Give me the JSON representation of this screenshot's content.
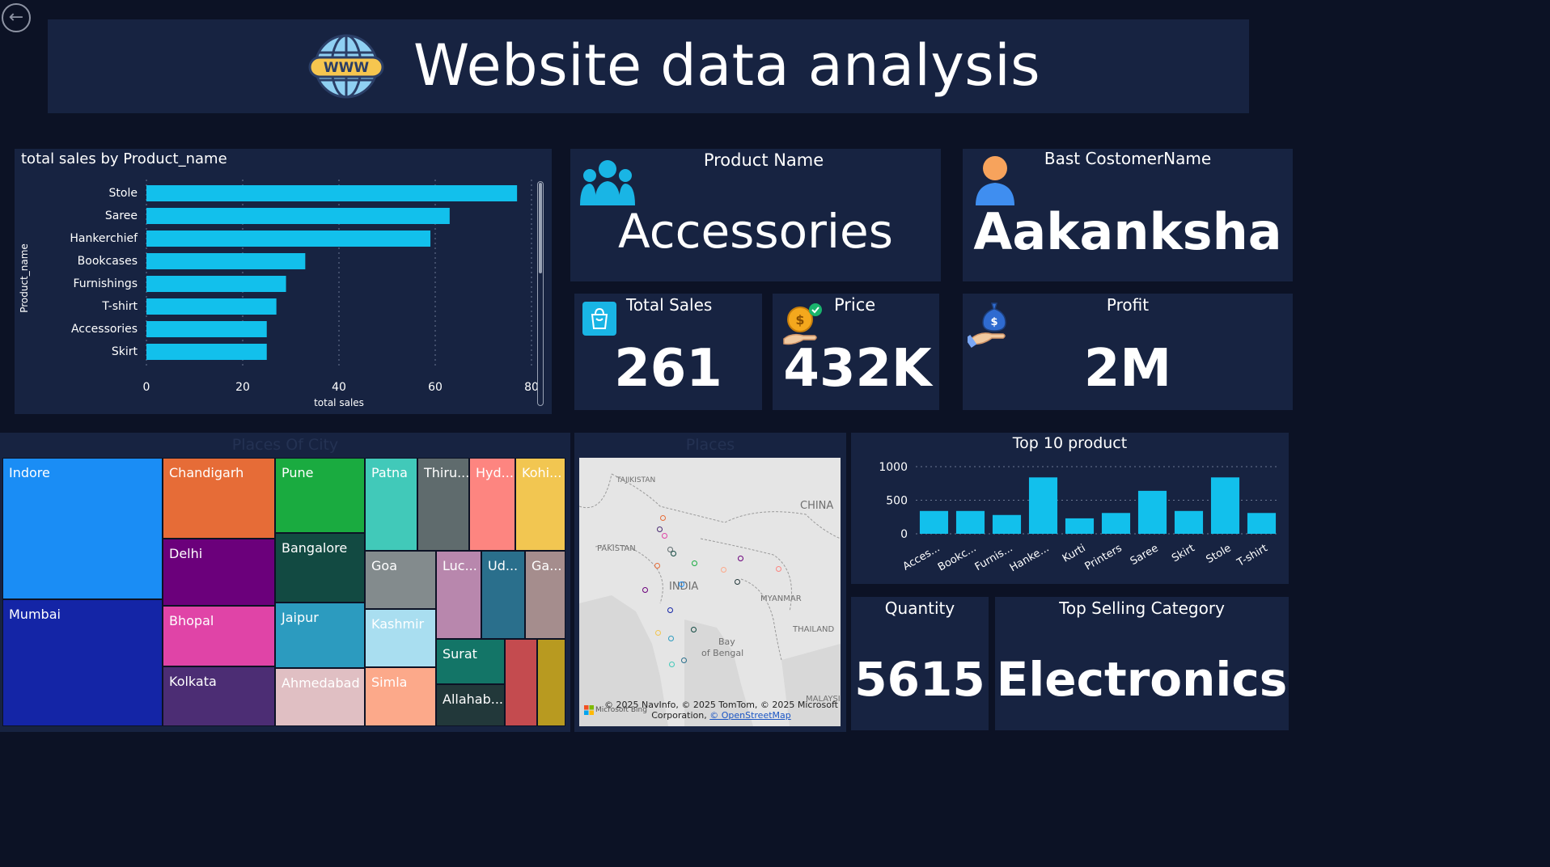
{
  "header": {
    "title": "Website data analysis",
    "icon": "www-globe-icon",
    "icon_text": "WWW"
  },
  "nav": {
    "back_icon": "back-arrow-icon"
  },
  "bar_chart": {
    "title": "total sales by Product_name",
    "chart_data": {
      "type": "bar",
      "orientation": "horizontal",
      "title": "total sales by Product_name",
      "xlabel": "total sales",
      "ylabel": "Product_name",
      "categories": [
        "Stole",
        "Saree",
        "Hankerchief",
        "Bookcases",
        "Furnishings",
        "T-shirt",
        "Accessories",
        "Skirt"
      ],
      "values": [
        77,
        63,
        59,
        33,
        29,
        27,
        25,
        25
      ],
      "xlim": [
        0,
        80
      ],
      "xticks": [
        0,
        20,
        40,
        60,
        80
      ],
      "grid": true,
      "color": "#12c0ec"
    }
  },
  "cards": {
    "product_name": {
      "label": "Product Name",
      "value": "Accessories",
      "icon": "people-group-icon"
    },
    "best_customer": {
      "label": "Bast CostomerName",
      "value": "Aakanksha",
      "icon": "user-avatar-icon"
    },
    "total_sales": {
      "label": "Total Sales",
      "value": "261",
      "icon": "shopping-bag-icon"
    },
    "price": {
      "label": "Price",
      "value": "432K",
      "icon": "coin-hand-icon"
    },
    "profit": {
      "label": "Profit",
      "value": "2M",
      "icon": "money-bag-hand-icon"
    },
    "quantity": {
      "label": "Quantity",
      "value": "5615"
    },
    "top_category": {
      "label": "Top Selling Category",
      "value": "Electronics"
    }
  },
  "treemap": {
    "title": "Places Of City",
    "cells": [
      {
        "label": "Indore",
        "color": "#1a8df5"
      },
      {
        "label": "Mumbai",
        "color": "#1425a6"
      },
      {
        "label": "Chandigarh",
        "color": "#e66c37"
      },
      {
        "label": "Delhi",
        "color": "#6b007b"
      },
      {
        "label": "Bhopal",
        "color": "#e044a7"
      },
      {
        "label": "Kolkata",
        "color": "#4c2d74"
      },
      {
        "label": "Pune",
        "color": "#1aab40"
      },
      {
        "label": "Bangalore",
        "color": "#124a42"
      },
      {
        "label": "Jaipur",
        "color": "#2c9bbf"
      },
      {
        "label": "Ahmedabad",
        "color": "#e0bfc3"
      },
      {
        "label": "Patna",
        "color": "#41c9b9"
      },
      {
        "label": "Thiru...",
        "color": "#5f6b6d"
      },
      {
        "label": "Hyd...",
        "color": "#fd8580"
      },
      {
        "label": "Kohi...",
        "color": "#f2c651"
      },
      {
        "label": "Goa",
        "color": "#838b8d"
      },
      {
        "label": "Luc...",
        "color": "#b887ad"
      },
      {
        "label": "Ud...",
        "color": "#2a6f8c"
      },
      {
        "label": "Ga...",
        "color": "#a58d8d"
      },
      {
        "label": "Kashmir",
        "color": "#a9def0"
      },
      {
        "label": "Surat",
        "color": "#137567"
      },
      {
        "label": "Simla",
        "color": "#fca98a"
      },
      {
        "label": "Allahab...",
        "color": "#22383a"
      },
      {
        "label": "",
        "color": "#c44b4f"
      },
      {
        "label": "",
        "color": "#b89a20"
      }
    ]
  },
  "map": {
    "title": "Places",
    "labels": {
      "tajikistan": "TAJIKISTAN",
      "china": "CHINA",
      "pakistan": "PAKISTAN",
      "india": "INDIA",
      "myanmar": "MYANMAR",
      "thailand": "THAILAND",
      "bay": "Bay",
      "bengal": "of Bengal",
      "malaysia": "MALAYSIA"
    },
    "credit_line1": "© 2025 NavInfo, © 2025 TomTom, © 2025 Microsoft",
    "credit_line2": "Corporation, ",
    "credit_link": "© OpenStreetMap",
    "bing": "Microsoft Bing"
  },
  "column_chart": {
    "title": "Top 10 product",
    "chart_data": {
      "type": "bar",
      "title": "Top 10 product",
      "categories": [
        "Acces...",
        "Bookc...",
        "Furnis...",
        "Hanke...",
        "Kurti",
        "Printers",
        "Saree",
        "Skirt",
        "Stole",
        "T-shirt"
      ],
      "values": [
        340,
        340,
        280,
        840,
        230,
        310,
        640,
        340,
        840,
        310
      ],
      "ylim": [
        0,
        1000
      ],
      "yticks": [
        0,
        500,
        1000
      ],
      "grid": true,
      "color": "#12c0ec"
    }
  }
}
